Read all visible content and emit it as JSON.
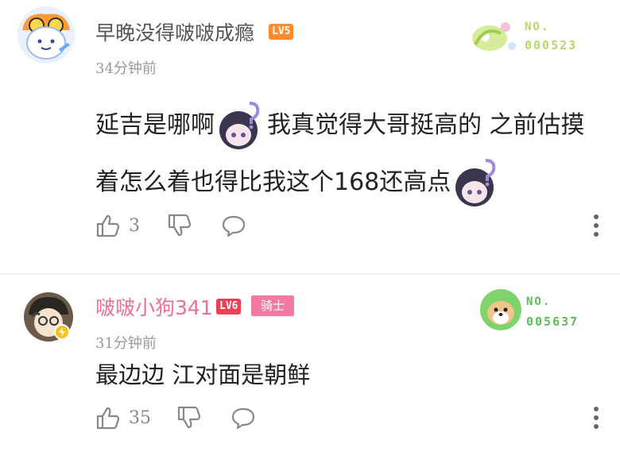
{
  "comments": [
    {
      "username": "早晚没得啵啵成瘾",
      "level": "LV5",
      "time": "34分钟前",
      "fan_number_label": "NO.",
      "fan_number": "000523",
      "text_parts": [
        "延吉是哪啊",
        "我真觉得大哥挺高的 之前估摸着怎么着也得比我这个168还高点"
      ],
      "likes": "3"
    },
    {
      "username": "啵啵小狗341",
      "level": "LV6",
      "medal": "骑士",
      "time": "31分钟前",
      "fan_number_label": "NO.",
      "fan_number": "005637",
      "text": "最边边 江对面是朝鲜",
      "likes": "35"
    }
  ],
  "colors": {
    "pink_name": "#ee6e9b",
    "lv5": "#ff8a2b",
    "lv6": "#ef3f52",
    "medal": "#f37aa1"
  },
  "icons": [
    "thumb-up-icon",
    "thumb-down-icon",
    "reply-bubble-icon",
    "more-vertical-icon"
  ]
}
